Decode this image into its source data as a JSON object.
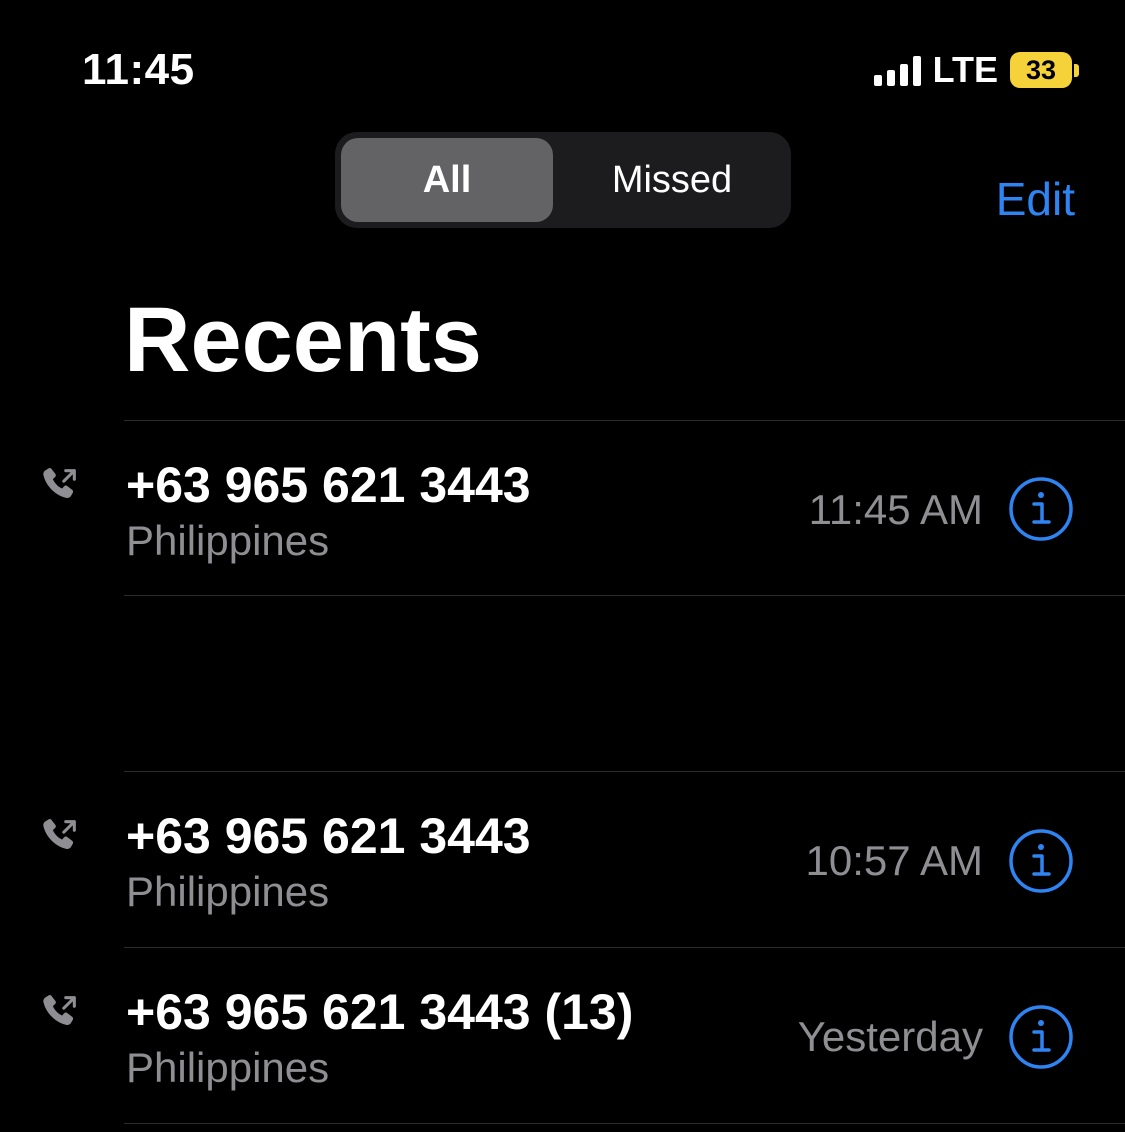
{
  "status_bar": {
    "time": "11:45",
    "network": "LTE",
    "battery": "33"
  },
  "segmented": {
    "all_label": "All",
    "missed_label": "Missed",
    "selected": "All"
  },
  "nav": {
    "edit_label": "Edit"
  },
  "title": "Recents",
  "calls": [
    {
      "number": "+63 965 621 3443",
      "label": "Philippines",
      "time": "11:45 AM"
    },
    {
      "number": "+63 965 621 3443",
      "label": "Philippines",
      "time": "10:57 AM"
    },
    {
      "number": "+63 965 621 3443 (13)",
      "label": "Philippines",
      "time": "Yesterday"
    }
  ],
  "icons": {
    "call_type": "outgoing-call-icon",
    "info": "info-icon",
    "signal": "cellular-signal-icon",
    "battery": "battery-icon"
  },
  "colors": {
    "background": "#000000",
    "accent": "#2d84f2",
    "secondary_text": "#8e8e93",
    "battery": "#f5d23a",
    "segment_bg": "#1c1c1e",
    "segment_selected": "#636366"
  }
}
